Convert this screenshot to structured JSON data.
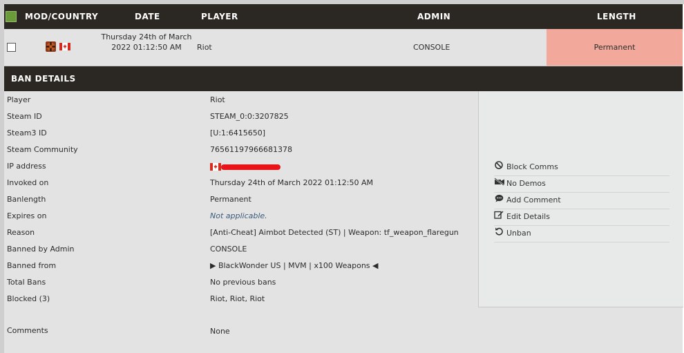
{
  "header": {
    "mod_country": "MOD/COUNTRY",
    "date": "DATE",
    "player": "PLAYER",
    "admin": "ADMIN",
    "length": "LENGTH"
  },
  "ban_row": {
    "date": "Thursday 24th of March 2022 01:12:50 AM",
    "player": "Riot",
    "admin": "CONSOLE",
    "length": "Permanent"
  },
  "details": {
    "title": "BAN DETAILS",
    "rows": [
      {
        "label": "Player",
        "value": "Riot"
      },
      {
        "label": "Steam ID",
        "value": "STEAM_0:0:3207825"
      },
      {
        "label": "Steam3 ID",
        "value": "[U:1:6415650]"
      },
      {
        "label": "Steam Community",
        "value": "76561197966681378"
      },
      {
        "label": "IP address",
        "value": ""
      },
      {
        "label": "Invoked on",
        "value": "Thursday 24th of March 2022 01:12:50 AM"
      },
      {
        "label": "Banlength",
        "value": "Permanent"
      },
      {
        "label": "Expires on",
        "value": "Not applicable."
      },
      {
        "label": "Reason",
        "value": "[Anti-Cheat] Aimbot Detected (ST) | Weapon: tf_weapon_flaregun"
      },
      {
        "label": "Banned by Admin",
        "value": "CONSOLE"
      },
      {
        "label": "Banned from",
        "value": "▶ BlackWonder US | MVM | x100 Weapons ◀"
      },
      {
        "label": "Total Bans",
        "value": "No previous bans"
      },
      {
        "label": "Blocked (3)",
        "value": "Riot, Riot, Riot"
      },
      {
        "label": "Comments",
        "value": "None"
      }
    ]
  },
  "actions": [
    {
      "label": "Block Comms",
      "icon": "block-icon"
    },
    {
      "label": "No Demos",
      "icon": "no-video-icon"
    },
    {
      "label": "Add Comment",
      "icon": "comment-icon"
    },
    {
      "label": "Edit Details",
      "icon": "edit-icon"
    },
    {
      "label": "Unban",
      "icon": "undo-icon"
    }
  ],
  "colors": {
    "header_bg": "#2b2722",
    "length_bg": "#f2a89b",
    "select_all": "#6a9a3a"
  }
}
